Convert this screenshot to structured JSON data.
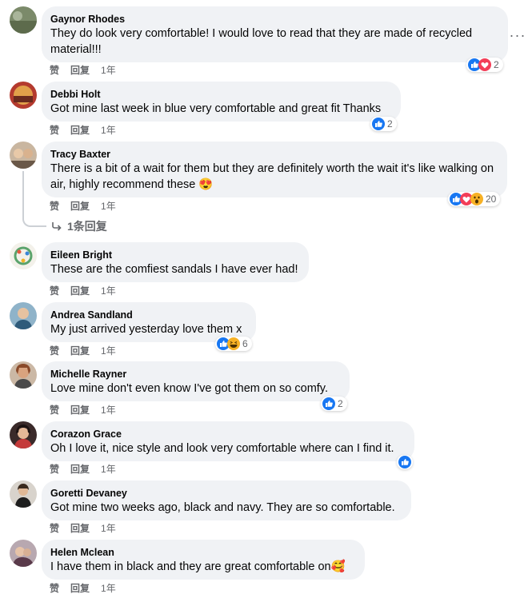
{
  "labels": {
    "like": "赞",
    "reply": "回复"
  },
  "comments": [
    {
      "name": "Gaynor Rhodes",
      "text": "They do look very comfortable! I would love to read that they are made of recycled material!!!",
      "time": "1年",
      "reactions": [
        "like",
        "love"
      ],
      "count": "2"
    },
    {
      "name": "Debbi Holt",
      "text": "Got mine last week in blue very comfortable and great fit Thanks",
      "time": "1年",
      "reactions": [
        "like"
      ],
      "count": "2"
    },
    {
      "name": "Tracy Baxter",
      "text": "There is a bit of a wait for them but they are definitely worth the wait it's like walking on air, highly recommend these 😍",
      "time": "1年",
      "reactions": [
        "like",
        "love",
        "wow"
      ],
      "count": "20",
      "replies_label": "1条回复"
    },
    {
      "name": "Eileen Bright",
      "text": "These are the comfiest sandals I have ever had!",
      "time": "1年"
    },
    {
      "name": "Andrea Sandland",
      "text": "My just arrived yesterday love them x",
      "time": "1年",
      "reactions": [
        "like",
        "haha"
      ],
      "count": "6"
    },
    {
      "name": "Michelle Rayner",
      "text": "Love mine don't even know I've got them on so comfy.",
      "time": "1年",
      "reactions": [
        "like"
      ],
      "count": "2"
    },
    {
      "name": "Corazon Grace",
      "text": "Oh I love it, nice style and look very comfortable where can I find it.",
      "time": "1年",
      "reactions": [
        "like"
      ],
      "count": ""
    },
    {
      "name": "Goretti Devaney",
      "text": "Got mine two weeks ago, black and navy. They are so comfortable.",
      "time": "1年"
    },
    {
      "name": "Helen Mclean",
      "text": "I have them in black and they are great comfortable on🥰",
      "time": "1年"
    }
  ],
  "icons": {
    "more": "more-options-icon",
    "reply_arrow": "reply-arrow-icon",
    "like": "like-reaction-icon",
    "love": "love-reaction-icon",
    "haha": "haha-reaction-icon",
    "wow": "wow-reaction-icon"
  },
  "colors": {
    "like": "#1877f2",
    "love": "#f33e58",
    "emoji": "#f7b125",
    "bubble": "#f0f2f5",
    "secondary_text": "#65676b"
  }
}
